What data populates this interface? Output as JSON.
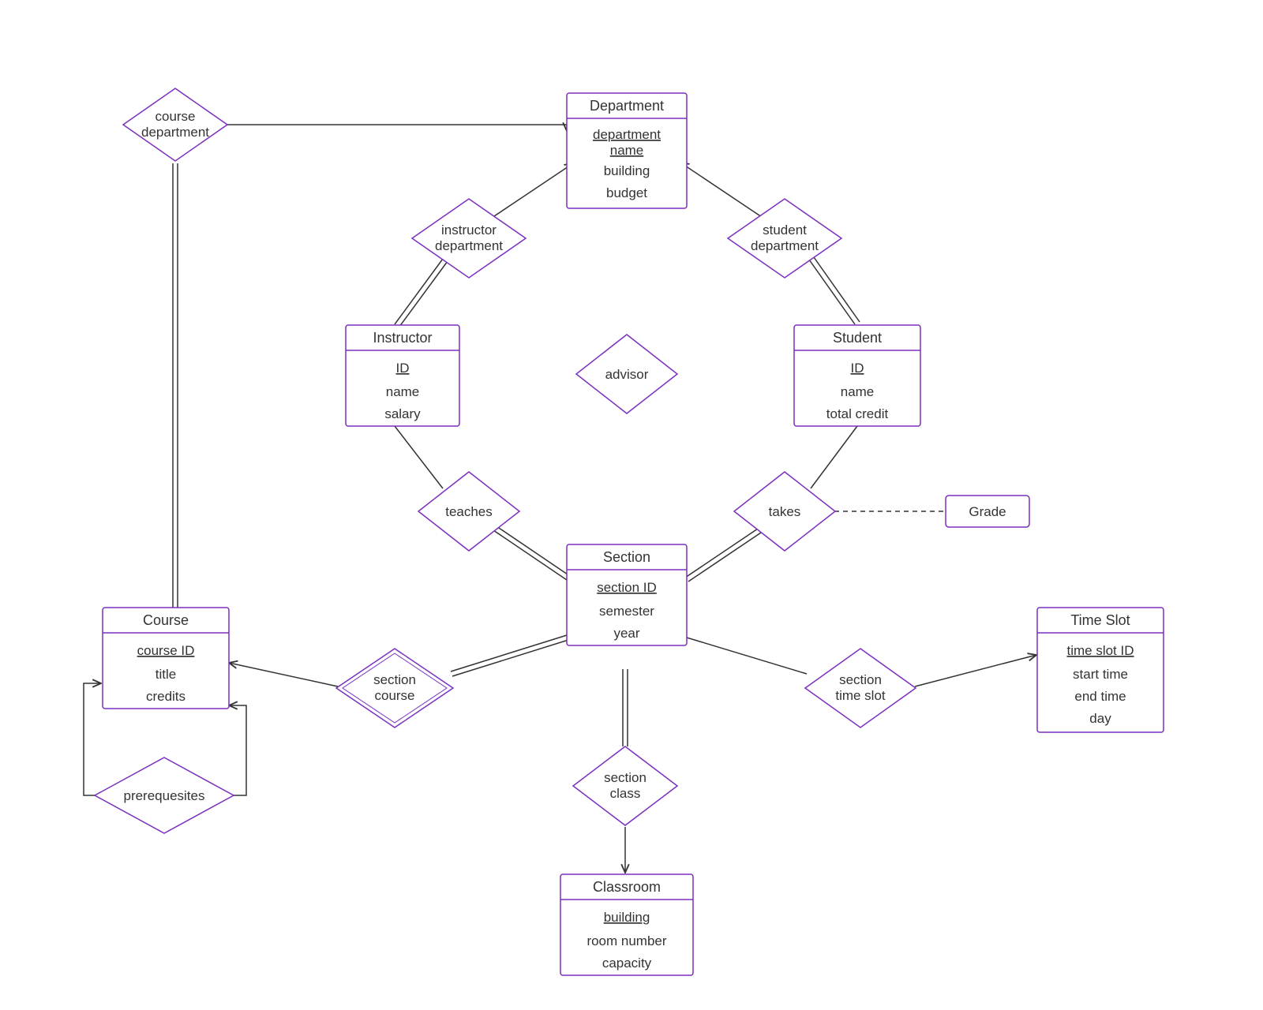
{
  "entities": {
    "department": {
      "title": "Department",
      "key": "department name",
      "attrs": [
        "building",
        "budget"
      ]
    },
    "instructor": {
      "title": "Instructor",
      "key": "ID",
      "attrs": [
        "name",
        "salary"
      ]
    },
    "student": {
      "title": "Student",
      "key": "ID",
      "attrs": [
        "name",
        "total credit"
      ]
    },
    "section": {
      "title": "Section",
      "key": "section ID",
      "attrs": [
        "semester",
        "year"
      ]
    },
    "course": {
      "title": "Course",
      "key": "course ID",
      "attrs": [
        "title",
        "credits"
      ]
    },
    "classroom": {
      "title": "Classroom",
      "key": "building",
      "attrs": [
        "room number",
        "capacity"
      ]
    },
    "timeslot": {
      "title": "Time Slot",
      "key": "time slot ID",
      "attrs": [
        "start time",
        "end time",
        "day"
      ]
    },
    "grade": {
      "title": "Grade"
    }
  },
  "relationships": {
    "course_department": {
      "l1": "course",
      "l2": "department"
    },
    "instructor_department": {
      "l1": "instructor",
      "l2": "department"
    },
    "student_department": {
      "l1": "student",
      "l2": "department"
    },
    "advisor": {
      "l1": "advisor"
    },
    "teaches": {
      "l1": "teaches"
    },
    "takes": {
      "l1": "takes"
    },
    "section_course": {
      "l1": "section",
      "l2": "course"
    },
    "section_class": {
      "l1": "section",
      "l2": "class"
    },
    "section_time_slot": {
      "l1": "section",
      "l2": "time slot"
    },
    "prerequisites": {
      "l1": "prerequesites"
    }
  }
}
